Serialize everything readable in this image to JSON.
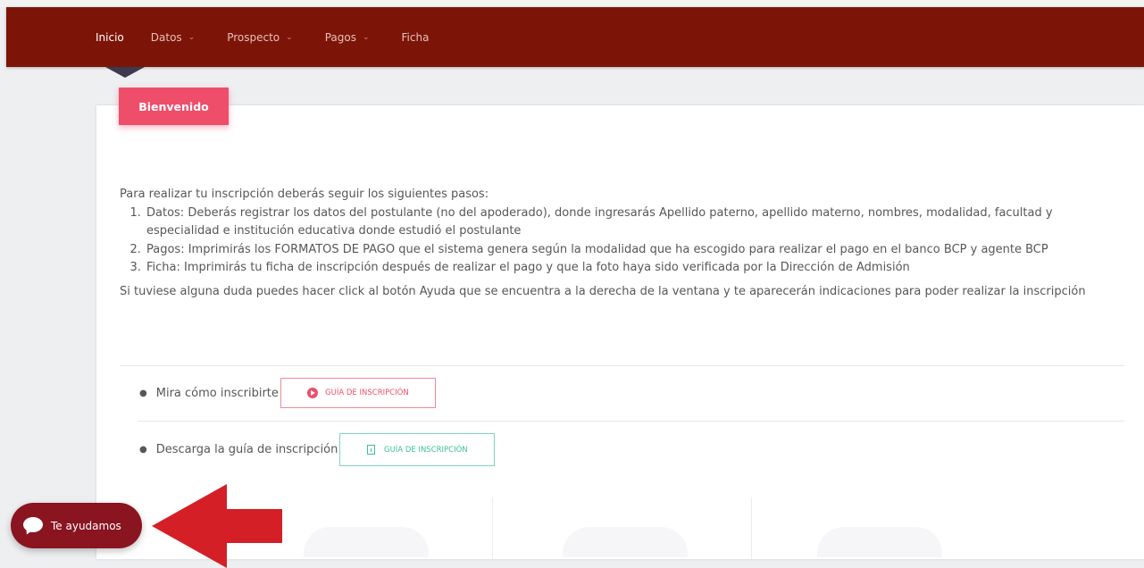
{
  "nav": {
    "items": [
      {
        "label": "Inicio",
        "active": true,
        "dropdown": false
      },
      {
        "label": "Datos",
        "active": false,
        "dropdown": true
      },
      {
        "label": "Prospecto",
        "active": false,
        "dropdown": true
      },
      {
        "label": "Pagos",
        "active": false,
        "dropdown": true
      },
      {
        "label": "Ficha",
        "active": false,
        "dropdown": false
      }
    ]
  },
  "welcome": {
    "badge": "Bienvenido"
  },
  "intro": "Para realizar tu inscripción deberás seguir los siguientes pasos:",
  "steps": [
    "Datos: Deberás registrar los datos del postulante (no del apoderado), donde ingresarás Apellido paterno, apellido materno, nombres, modalidad, facultad y especialidad e institución educativa donde estudió el postulante",
    "Pagos: Imprimirás los FORMATOS DE PAGO que el sistema genera según la modalidad que ha escogido para realizar el pago en el banco BCP y agente BCP",
    "Ficha: Imprimirás tu ficha de inscripción después de realizar el pago y que la foto haya sido verificada por la Dirección de Admisión"
  ],
  "help_note": "Si tuviese alguna duda puedes hacer click al botón Ayuda que se encuentra a la derecha de la ventana y te aparecerán indicaciones para poder realizar la inscripción",
  "resources": {
    "video": {
      "text": "Mira cómo inscribirte",
      "button": "GUÍA DE INSCRIPCIÓN",
      "icon": "youtube-icon"
    },
    "download": {
      "text": "Descarga la guía de inscripción",
      "button": "GUÍA DE INSCRIPCIÓN",
      "icon": "document-icon"
    }
  },
  "chat": {
    "label": "Te ayudamos",
    "icon": "chat-bubble-icon"
  },
  "colors": {
    "navbar": "#7c1508",
    "badge": "#ee4e6a",
    "video_button": "#ee4e6a",
    "download_button": "#3bbf93",
    "chat_button": "#8a1420",
    "arrow": "#d41f26"
  }
}
